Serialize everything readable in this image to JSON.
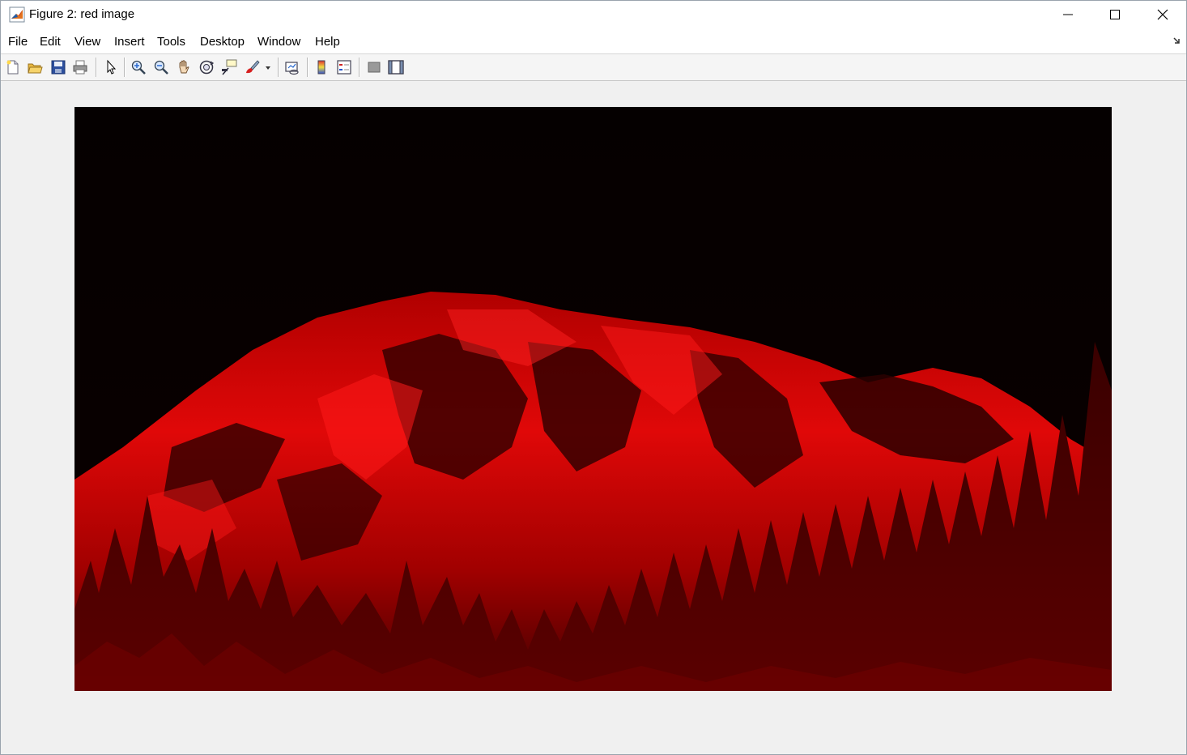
{
  "window": {
    "title": "Figure 2: red image"
  },
  "menubar": {
    "items": [
      "File",
      "Edit",
      "View",
      "Insert",
      "Tools",
      "Desktop",
      "Window",
      "Help"
    ]
  },
  "toolbar": {
    "buttons": [
      "new-figure-icon",
      "open-file-icon",
      "save-icon",
      "print-icon",
      "select-arrow-icon",
      "zoom-in-icon",
      "zoom-out-icon",
      "pan-hand-icon",
      "rotate-3d-icon",
      "data-cursor-icon",
      "brush-icon",
      "brush-dropdown-icon",
      "link-plot-icon",
      "insert-colorbar-icon",
      "insert-legend-icon",
      "hide-plot-tools-icon",
      "show-plot-tools-icon"
    ]
  },
  "figure": {
    "image_description_color": "#cc0000",
    "background": "#000000"
  }
}
